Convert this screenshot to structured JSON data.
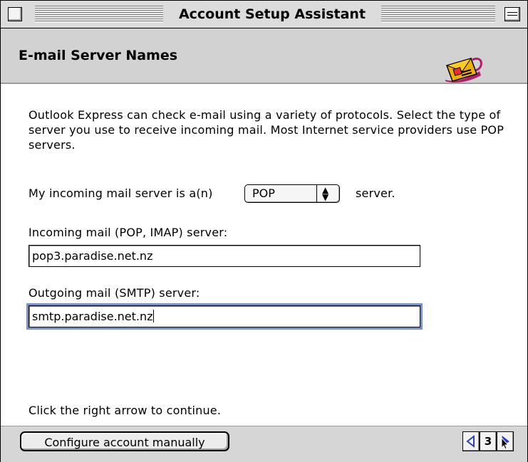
{
  "window": {
    "title": "Account Setup Assistant"
  },
  "header": {
    "title": "E-mail Server Names",
    "logo_icon": "outlook-express-envelope-icon"
  },
  "intro_text": "Outlook Express can check e-mail using a variety of protocols. Select the type of server you use to receive incoming mail. Most Internet service providers use POP servers.",
  "server_type": {
    "label_before": "My incoming mail server is a(n)",
    "selected": "POP",
    "label_after": "server."
  },
  "incoming": {
    "label": "Incoming mail (POP, IMAP) server:",
    "value": "pop3.paradise.net.nz"
  },
  "outgoing": {
    "label": "Outgoing mail (SMTP) server:",
    "value": "smtp.paradise.net.nz"
  },
  "instruction": "Click the right arrow to continue.",
  "footer": {
    "configure_button": "Configure account manually",
    "page_number": "3",
    "prev_icon": "left-arrow-icon",
    "next_icon": "right-arrow-icon"
  },
  "colors": {
    "focus_ring": "#7a92c4",
    "header_bg": "#d2d2d2",
    "nav_arrow": "#2a3fb8"
  }
}
